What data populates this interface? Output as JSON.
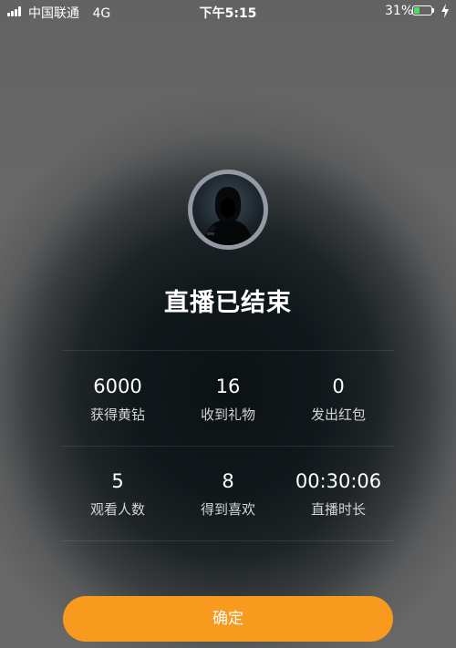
{
  "status_bar": {
    "carrier": "中国联通",
    "network": "4G",
    "time": "下午5:15",
    "battery_percent": "31%",
    "battery_level": 0.31,
    "battery_color": "#4cd964"
  },
  "live_end": {
    "title": "直播已结束",
    "stats": [
      {
        "value": "6000",
        "label": "获得黄钻"
      },
      {
        "value": "16",
        "label": "收到礼物"
      },
      {
        "value": "0",
        "label": "发出红包"
      },
      {
        "value": "5",
        "label": "观看人数"
      },
      {
        "value": "8",
        "label": "得到喜欢"
      },
      {
        "value": "00:30:06",
        "label": "直播时长"
      }
    ],
    "confirm_label": "确定",
    "accent_color": "#f79a1e"
  },
  "icons": {
    "signal": "signal-strength-icon",
    "battery": "battery-icon",
    "charging": "charging-bolt-icon",
    "avatar": "hooded-figure-avatar"
  }
}
